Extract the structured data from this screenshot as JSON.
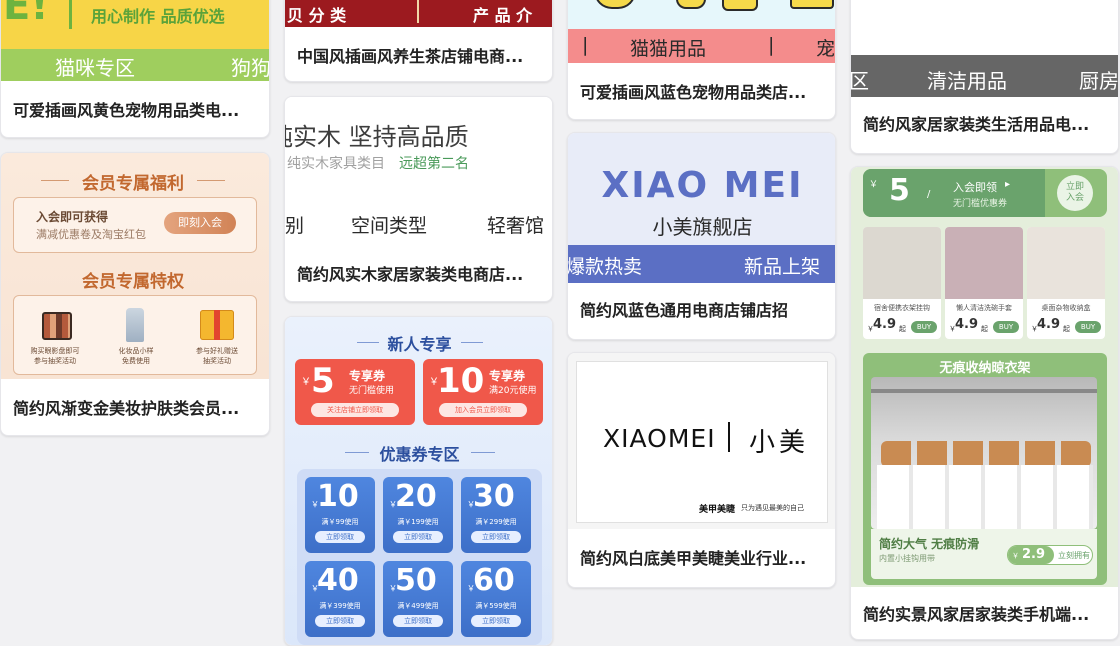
{
  "cards": [
    {
      "title": "可爱插画风黄色宠物用品类电...",
      "banner_partial": "E!",
      "slogan": "用心制作 品质优选",
      "nav": [
        "猫咪专区",
        "狗狗"
      ]
    },
    {
      "title": "简约风渐变金美妆护肤类会员...",
      "member_title": "会员专属福利",
      "join_heading": "入会即可获得",
      "join_desc": "满减优惠卷及淘宝红包",
      "join_button": "即刻入会",
      "privilege_title": "会员专属特权",
      "privileges": [
        {
          "label": "购买眼影盘即可\n参与抽奖活动",
          "icon": "eyeshadow-palette-icon"
        },
        {
          "label": "化妆品小样\n免费使用",
          "icon": "serum-bottle-icon"
        },
        {
          "label": "参与好礼赠送\n抽奖活动",
          "icon": "gift-box-icon"
        }
      ]
    },
    {
      "title": "中国风插画风养生茶店铺电商...",
      "nav": [
        "贝 分 类",
        "产 品 介"
      ]
    },
    {
      "title": "简约风实木家居家装类电商店...",
      "headline": "纯实木  坚持高品质",
      "sub_gray": "纯实木家具类目",
      "sub_green": "远超第二名",
      "nav": [
        "别",
        "空间类型",
        "轻奢馆"
      ]
    },
    {
      "new_title": "新人专享",
      "coupons_big": [
        {
          "amount": "5",
          "name": "专享券",
          "cond": "无门槛使用",
          "btn": "关注店铺立即领取"
        },
        {
          "amount": "10",
          "name": "专享券",
          "cond": "满20元使用",
          "btn": "加入会员立即领取"
        }
      ],
      "zone_title": "优惠券专区",
      "coupons": [
        {
          "amount": "10",
          "cond": "满￥99使用",
          "btn": "立即领取"
        },
        {
          "amount": "20",
          "cond": "满￥199使用",
          "btn": "立即领取"
        },
        {
          "amount": "30",
          "cond": "满￥299使用",
          "btn": "立即领取"
        },
        {
          "amount": "40",
          "cond": "满￥399使用",
          "btn": "立即领取"
        },
        {
          "amount": "50",
          "cond": "满￥499使用",
          "btn": "立即领取"
        },
        {
          "amount": "60",
          "cond": "满￥599使用",
          "btn": "立即领取"
        }
      ],
      "currency": "￥"
    },
    {
      "title": "可爱插画风蓝色宠物用品类店...",
      "nav": [
        "|",
        "猫猫用品",
        "|",
        "宠"
      ]
    },
    {
      "title": "简约风蓝色通用电商店铺店招",
      "brand_en": "XIAO MEI",
      "brand_cn": "小美旗舰店",
      "nav": [
        "爆款热卖",
        "新品上架"
      ]
    },
    {
      "title": "简约风白底美甲美睫美业行业...",
      "logo_en": "XIAOMEI",
      "logo_cn": "小美",
      "tagline_bold": "美甲美睫",
      "tagline": "只为遇见最美的自己"
    },
    {
      "title": "简约风家居家装类生活用品电...",
      "nav": [
        "区",
        "清洁用品",
        "厨房"
      ]
    },
    {
      "title": "简约实景风家居家装类手机端...",
      "coupon_amount": "5",
      "coupon_head": "入会即领",
      "coupon_sub": "无门槛优惠券",
      "join_btn": "立即\n入会",
      "products": [
        {
          "name": "宿舍便携衣架挂钩",
          "price": "4.9",
          "unit": "起",
          "buy": "BUY"
        },
        {
          "name": "懒人清洁洗碗手套",
          "price": "4.9",
          "unit": "起",
          "buy": "BUY"
        },
        {
          "name": "桌面杂物收纳盒",
          "price": "4.9",
          "unit": "起",
          "buy": "BUY"
        }
      ],
      "rack_title": "无痕收纳晾衣架",
      "rack_slogan": "简约大气 无痕防滑",
      "rack_sub": "内置小挂钩用带",
      "rack_price": "2.9",
      "rack_btn": "立刻拥有"
    }
  ],
  "colors": {
    "yellow": "#f7d547",
    "green_pet": "#9fce5e",
    "tea_red": "#9c1a1f",
    "coupon_red": "#f0584a",
    "blue_brand": "#5b6fc4",
    "green_home": "#6aa36c"
  }
}
